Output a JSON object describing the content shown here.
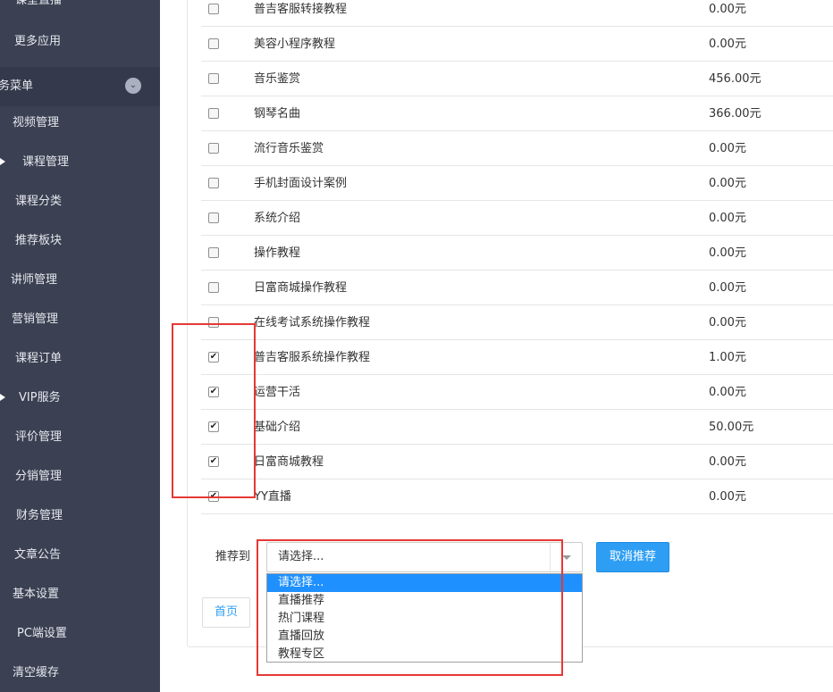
{
  "sidebar": {
    "items": [
      {
        "label": "更多应用"
      },
      {
        "label": "务菜单"
      },
      {
        "label": "视频管理"
      },
      {
        "label": "课程管理"
      },
      {
        "label": "课程分类"
      },
      {
        "label": "推荐板块"
      },
      {
        "label": "讲师管理"
      },
      {
        "label": "营销管理"
      },
      {
        "label": "课程订单"
      },
      {
        "label": "VIP服务"
      },
      {
        "label": "评价管理"
      },
      {
        "label": "分销管理"
      },
      {
        "label": "财务管理"
      },
      {
        "label": "文章公告"
      },
      {
        "label": "基本设置"
      },
      {
        "label": "PC端设置"
      },
      {
        "label": "清空缓存"
      }
    ]
  },
  "courses": [
    {
      "name": "普吉客服转接教程",
      "price": "0.00元",
      "checked": false
    },
    {
      "name": "美容小程序教程",
      "price": "0.00元",
      "checked": false
    },
    {
      "name": "音乐鉴赏",
      "price": "456.00元",
      "checked": false
    },
    {
      "name": "钢琴名曲",
      "price": "366.00元",
      "checked": false
    },
    {
      "name": "流行音乐鉴赏",
      "price": "0.00元",
      "checked": false
    },
    {
      "name": "手机封面设计案例",
      "price": "0.00元",
      "checked": false
    },
    {
      "name": "系统介绍",
      "price": "0.00元",
      "checked": false
    },
    {
      "name": "操作教程",
      "price": "0.00元",
      "checked": false
    },
    {
      "name": "日富商城操作教程",
      "price": "0.00元",
      "checked": false
    },
    {
      "name": "在线考试系统操作教程",
      "price": "0.00元",
      "checked": false
    },
    {
      "name": "普吉客服系统操作教程",
      "price": "1.00元",
      "checked": true
    },
    {
      "name": "运营干活",
      "price": "0.00元",
      "checked": true
    },
    {
      "name": "基础介绍",
      "price": "50.00元",
      "checked": true
    },
    {
      "name": "日富商城教程",
      "price": "0.00元",
      "checked": true
    },
    {
      "name": "YY直播",
      "price": "0.00元",
      "checked": true
    }
  ],
  "recommend": {
    "label": "推荐到",
    "selected": "请选择...",
    "cancel_label": "取消推荐",
    "options": [
      "请选择...",
      "直播推荐",
      "热门课程",
      "直播回放",
      "教程专区"
    ]
  },
  "pager": {
    "first_label": "首页"
  },
  "icons": {
    "checkmark": "✔",
    "expand": "chevron-down-icon"
  },
  "colors": {
    "sidebar_bg": "#3b4052",
    "accent": "#2e9ef4",
    "highlight": "#e53935"
  }
}
